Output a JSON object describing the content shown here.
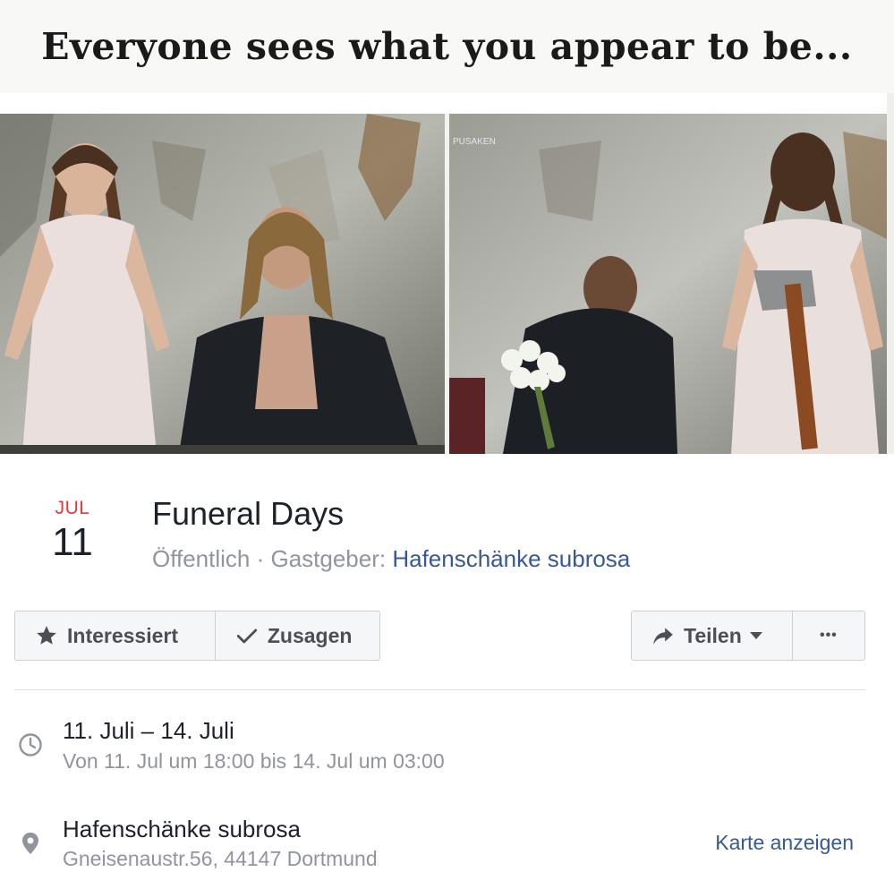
{
  "cover": {
    "caption": "Everyone sees what you appear to be...",
    "watermark": "PUSAKEN"
  },
  "event": {
    "month": "JUL",
    "day": "11",
    "title": "Funeral Days",
    "privacy": "Öffentlich",
    "separator": " · ",
    "host_prefix": "Gastgeber: ",
    "host": "Hafenschänke subrosa"
  },
  "actions": {
    "interested_label": "Interessiert",
    "going_label": "Zusagen",
    "share_label": "Teilen",
    "more_label": "•••"
  },
  "details": {
    "date_title": "11. Juli – 14. Juli",
    "date_sub": "Von 11. Jul um 18:00 bis 14. Jul um 03:00",
    "location_title": "Hafenschänke subrosa",
    "location_sub": "Gneisenaustr.56, 44147 Dortmund",
    "map_link": "Karte anzeigen"
  },
  "colors": {
    "month_red": "#e0393e",
    "link_blue": "#365899",
    "muted_gray": "#90949c",
    "text_dark": "#1d2129"
  }
}
